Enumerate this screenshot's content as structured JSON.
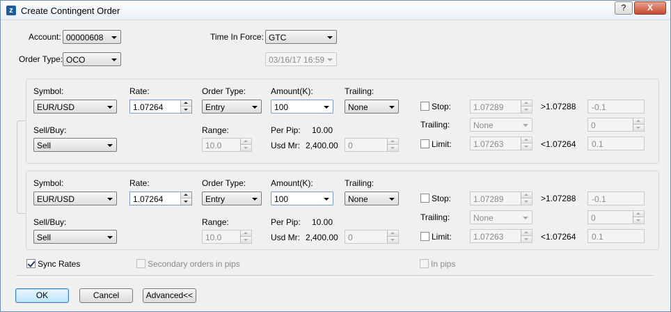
{
  "window": {
    "title": "Create Contingent Order",
    "help_label": "?",
    "close_label": "X"
  },
  "header": {
    "account_label": "Account:",
    "account_value": "00000608",
    "order_type_label": "Order Type:",
    "order_type_value": "OCO",
    "tif_label": "Time In Force:",
    "tif_value": "GTC",
    "expiry_value": "03/16/17 16:59"
  },
  "orders": [
    {
      "symbol_label": "Symbol:",
      "symbol_value": "EUR/USD",
      "rate_label": "Rate:",
      "rate_value": "1.07264",
      "order_type_label": "Order Type:",
      "order_type_value": "Entry",
      "amount_label": "Amount(K):",
      "amount_value": "100",
      "trailing_label": "Trailing:",
      "trailing_value": "None",
      "sellbuy_label": "Sell/Buy:",
      "sellbuy_value": "Sell",
      "range_label": "Range:",
      "range_value": "10.0",
      "per_pip_label": "Per Pip:",
      "per_pip_value": "10.00",
      "usd_mr_label": "Usd Mr:",
      "usd_mr_value": "2,400.00",
      "range2_value": "0",
      "stop_label": "Stop:",
      "stop_rate": "1.07289",
      "stop_bound": ">1.07288",
      "stop_pips": "-0.1",
      "stop_trailing_label": "Trailing:",
      "stop_trailing_value": "None",
      "stop_trailing_num": "0",
      "limit_label": "Limit:",
      "limit_rate": "1.07263",
      "limit_bound": "<1.07264",
      "limit_pips": "0.1"
    },
    {
      "symbol_label": "Symbol:",
      "symbol_value": "EUR/USD",
      "rate_label": "Rate:",
      "rate_value": "1.07264",
      "order_type_label": "Order Type:",
      "order_type_value": "Entry",
      "amount_label": "Amount(K):",
      "amount_value": "100",
      "trailing_label": "Trailing:",
      "trailing_value": "None",
      "sellbuy_label": "Sell/Buy:",
      "sellbuy_value": "Sell",
      "range_label": "Range:",
      "range_value": "10.0",
      "per_pip_label": "Per Pip:",
      "per_pip_value": "10.00",
      "usd_mr_label": "Usd Mr:",
      "usd_mr_value": "2,400.00",
      "range2_value": "0",
      "stop_label": "Stop:",
      "stop_rate": "1.07289",
      "stop_bound": ">1.07288",
      "stop_pips": "-0.1",
      "stop_trailing_label": "Trailing:",
      "stop_trailing_value": "None",
      "stop_trailing_num": "0",
      "limit_label": "Limit:",
      "limit_rate": "1.07263",
      "limit_bound": "<1.07264",
      "limit_pips": "0.1"
    }
  ],
  "options": {
    "sync_rates": "Sync Rates",
    "secondary_pips": "Secondary orders in pips",
    "in_pips": "In pips"
  },
  "buttons": {
    "ok": "OK",
    "cancel": "Cancel",
    "advanced": "Advanced<<"
  }
}
